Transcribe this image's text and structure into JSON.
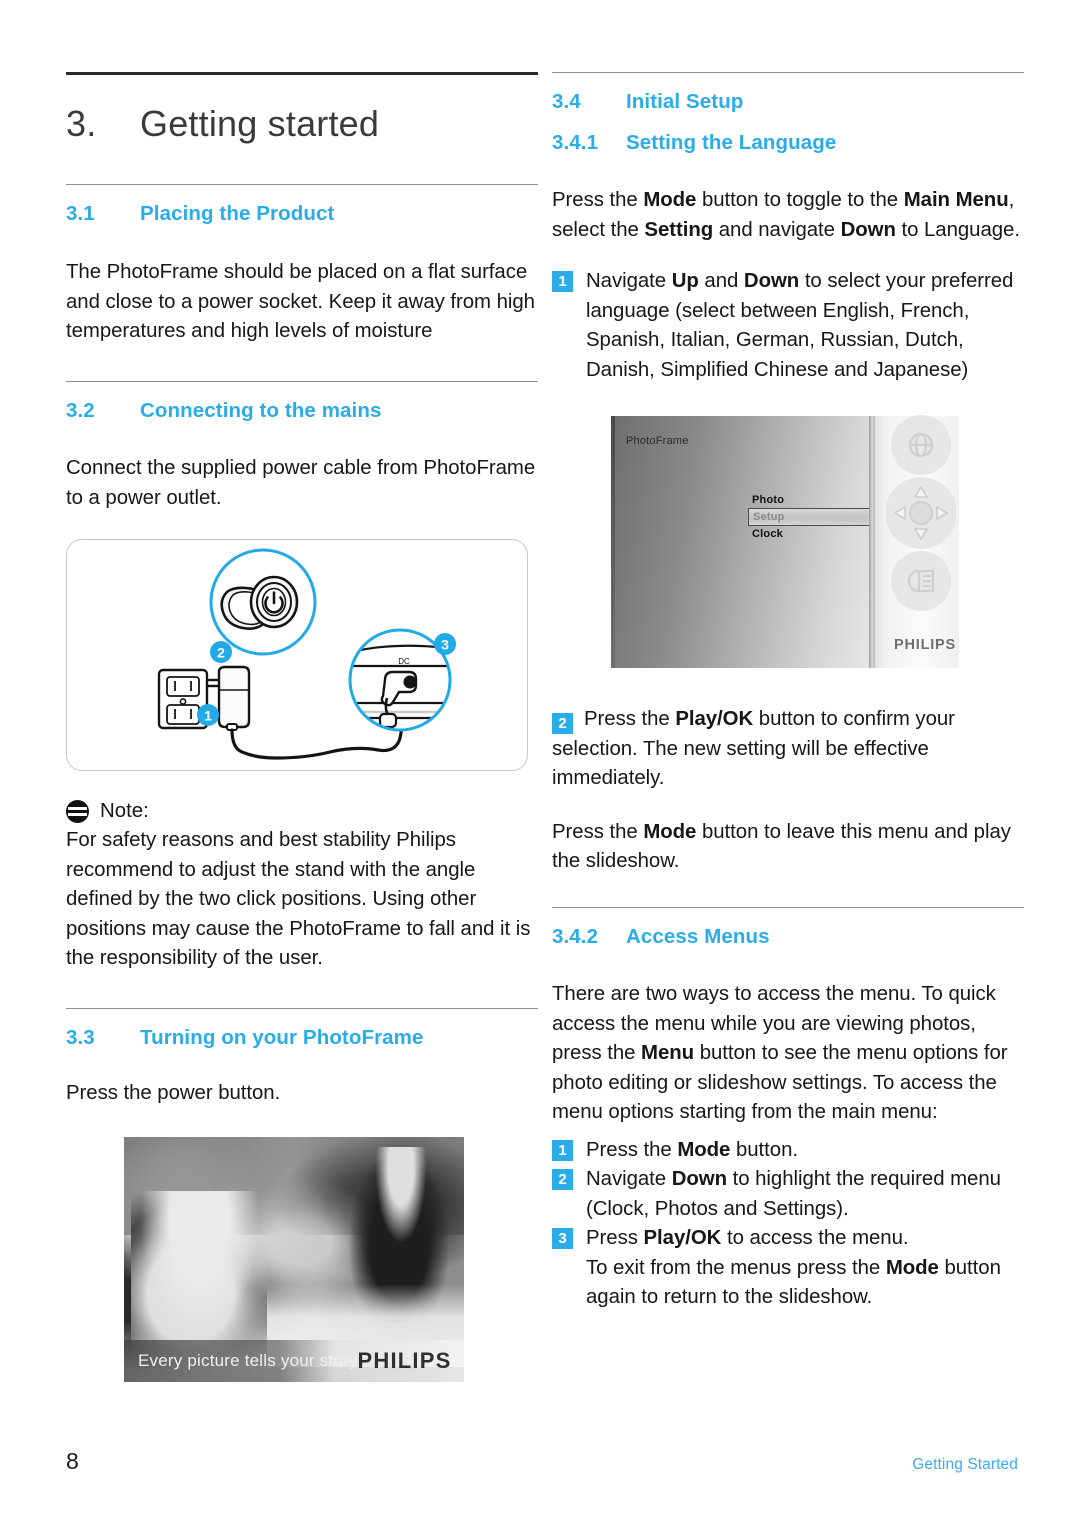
{
  "document": {
    "page_number": "8",
    "footer_label": "Getting Started",
    "accent_color": "#29ace7"
  },
  "chapter": {
    "number": "3.",
    "title": "Getting started"
  },
  "left_column": {
    "section_31": {
      "number": "3.1",
      "title": "Placing the Product",
      "body": "The PhotoFrame should be placed on a flat surface and close to a power socket.  Keep it away from high temperatures and high levels of moisture"
    },
    "section_32": {
      "number": "3.2",
      "title": "Connecting to the mains",
      "body": "Connect the supplied power cable from PhotoFrame to a power outlet."
    },
    "diagram": {
      "name": "power-connection-diagram",
      "callouts": [
        "1",
        "2",
        "3"
      ],
      "dc_label": "DC"
    },
    "note": {
      "label": "Note:",
      "body": "For safety reasons and best stability Philips recommend to adjust the stand with the angle defined by the two click positions. Using other positions may cause the PhotoFrame to fall and it is the responsibility of the user."
    },
    "section_33": {
      "number": "3.3",
      "title": "Turning on your PhotoFrame",
      "body": "Press the power button."
    },
    "photo": {
      "tagline": "Every picture tells your story",
      "brand": "PHILIPS"
    }
  },
  "right_column": {
    "section_34": {
      "number": "3.4",
      "title": "Initial Setup"
    },
    "section_341": {
      "number": "3.4.1",
      "title": "Setting the Language",
      "intro_parts": [
        {
          "text": "Press the ",
          "bold": false
        },
        {
          "text": "Mode",
          "bold": true
        },
        {
          "text": " button to toggle to the ",
          "bold": false
        },
        {
          "text": "Main Menu",
          "bold": true
        },
        {
          "text": ", select the ",
          "bold": false
        },
        {
          "text": "Setting",
          "bold": true
        },
        {
          "text": " and navigate ",
          "bold": false
        },
        {
          "text": "Down",
          "bold": true
        },
        {
          "text": " to Language.",
          "bold": false
        }
      ],
      "step1": {
        "marker": "1",
        "parts": [
          {
            "text": "Navigate ",
            "bold": false
          },
          {
            "text": "Up",
            "bold": true
          },
          {
            "text": " and ",
            "bold": false
          },
          {
            "text": "Down",
            "bold": true
          },
          {
            "text": " to select your preferred language (select between English, French, Spanish, Italian, German, Russian, Dutch, Danish, Simplified Chinese and Japanese)",
            "bold": false
          }
        ]
      },
      "step2": {
        "marker": "2",
        "parts": [
          {
            "text": "Press the ",
            "bold": false
          },
          {
            "text": "Play/OK",
            "bold": true
          },
          {
            "text": " button to confirm your selection. The new setting will be effective immediately.",
            "bold": false
          }
        ]
      },
      "outro_parts": [
        {
          "text": "Press the ",
          "bold": false
        },
        {
          "text": "Mode",
          "bold": true
        },
        {
          "text": " button to leave this menu and play the slideshow.",
          "bold": false
        }
      ]
    },
    "device_screenshot": {
      "screen_title": "PhotoFrame",
      "menu_items": [
        "Photo",
        "Setup",
        "Clock"
      ],
      "selected_menu_item": "Setup",
      "brand": "PHILIPS",
      "buttons": [
        "globe-button",
        "navigation-pad",
        "menu-button"
      ]
    },
    "section_342": {
      "number": "3.4.2",
      "title": "Access Menus",
      "intro_parts": [
        {
          "text": "There are two ways to access the menu. To quick access the menu while you are viewing photos, press the ",
          "bold": false
        },
        {
          "text": "Menu",
          "bold": true
        },
        {
          "text": " button to see the menu options for photo editing or slideshow settings. To access the menu options starting from the main menu:",
          "bold": false
        }
      ],
      "steps": [
        {
          "marker": "1",
          "parts": [
            {
              "text": "Press the ",
              "bold": false
            },
            {
              "text": "Mode",
              "bold": true
            },
            {
              "text": " button.",
              "bold": false
            }
          ]
        },
        {
          "marker": "2",
          "parts": [
            {
              "text": "Navigate ",
              "bold": false
            },
            {
              "text": "Down",
              "bold": true
            },
            {
              "text": " to highlight the required menu (Clock, Photos and Settings).",
              "bold": false
            }
          ]
        },
        {
          "marker": "3",
          "parts": [
            {
              "text": "Press ",
              "bold": false
            },
            {
              "text": "Play/OK",
              "bold": true
            },
            {
              "text": " to access the menu.",
              "bold": false
            }
          ]
        }
      ],
      "closing_parts": [
        {
          "text": "To exit from the menus press the ",
          "bold": false
        },
        {
          "text": "Mode",
          "bold": true
        },
        {
          "text": " button again to return to the slideshow.",
          "bold": false
        }
      ]
    }
  }
}
